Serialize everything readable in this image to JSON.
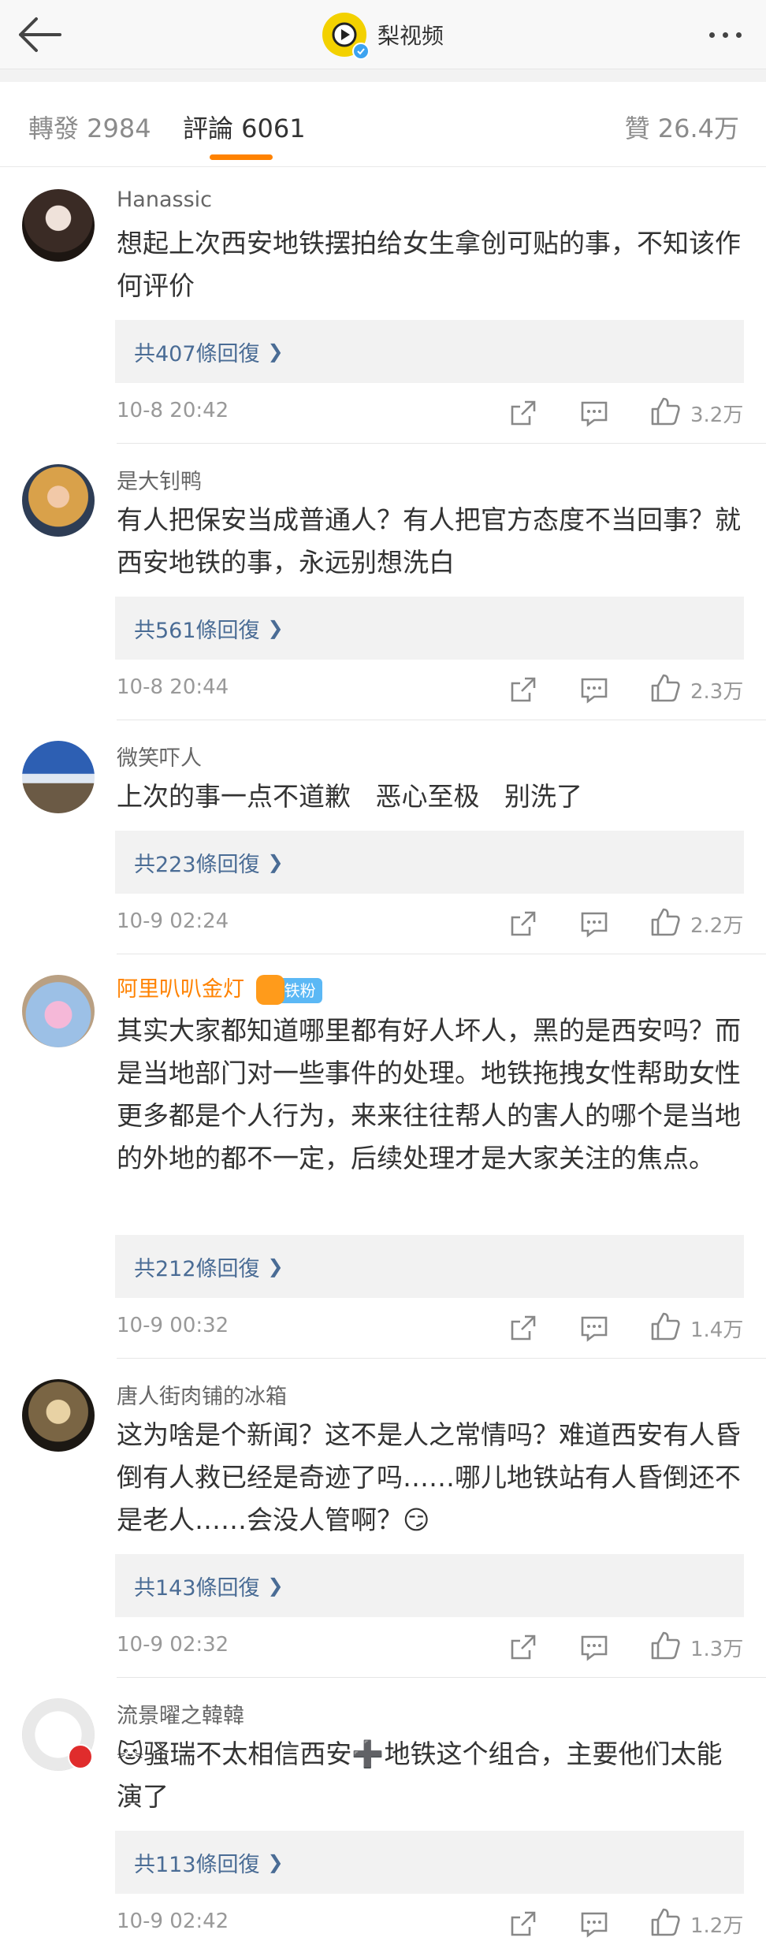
{
  "nav": {
    "brand_name": "梨视频"
  },
  "tabs": {
    "repost": "轉發 2984",
    "comments": "評論 6061",
    "likes": "贊 26.4万"
  },
  "colors": {
    "accent": "#ff8200",
    "link": "#4a6c95"
  },
  "comments": [
    {
      "user": "Hanassic",
      "text": "想起上次西安地铁摆拍给女生拿创可贴的事，不知该作何评价",
      "replies": "共407條回復",
      "time": "10-8 20:42",
      "likes": "3.2万"
    },
    {
      "user": "是大钊鸭",
      "text": "有人把保安当成普通人？有人把官方态度不当回事？就西安地铁的事，永远别想洗白",
      "replies": "共561條回復",
      "time": "10-8 20:44",
      "likes": "2.3万"
    },
    {
      "user": "微笑吓人",
      "text": "上次的事一点不道歉   恶心至极   别洗了",
      "replies": "共223條回復",
      "time": "10-9 02:24",
      "likes": "2.2万"
    },
    {
      "user": "阿里叭叭金灯",
      "badge": "铁粉",
      "text": "其实大家都知道哪里都有好人坏人，黑的是西安吗？而是当地部门对一些事件的处理。地铁拖拽女性帮助女性更多都是个人行为，来来往往帮人的害人的哪个是当地的外地的都不一定，后续处理才是大家关注的焦点。",
      "replies": "共212條回復",
      "time": "10-9 00:32",
      "likes": "1.4万"
    },
    {
      "user": "唐人街肉铺的冰箱",
      "text": "这为啥是个新闻？这不是人之常情吗？难道西安有人昏倒有人救已经是奇迹了吗……哪儿地铁站有人昏倒还不是老人……会没人管啊？😏",
      "replies": "共143條回復",
      "time": "10-9 02:32",
      "likes": "1.3万"
    },
    {
      "user": "流景曜之韓韓",
      "text": "🐱骚瑞不太相信西安➕地铁这个组合，主要他们太能演了",
      "replies": "共113條回復",
      "time": "10-9 02:42",
      "likes": "1.2万"
    }
  ]
}
